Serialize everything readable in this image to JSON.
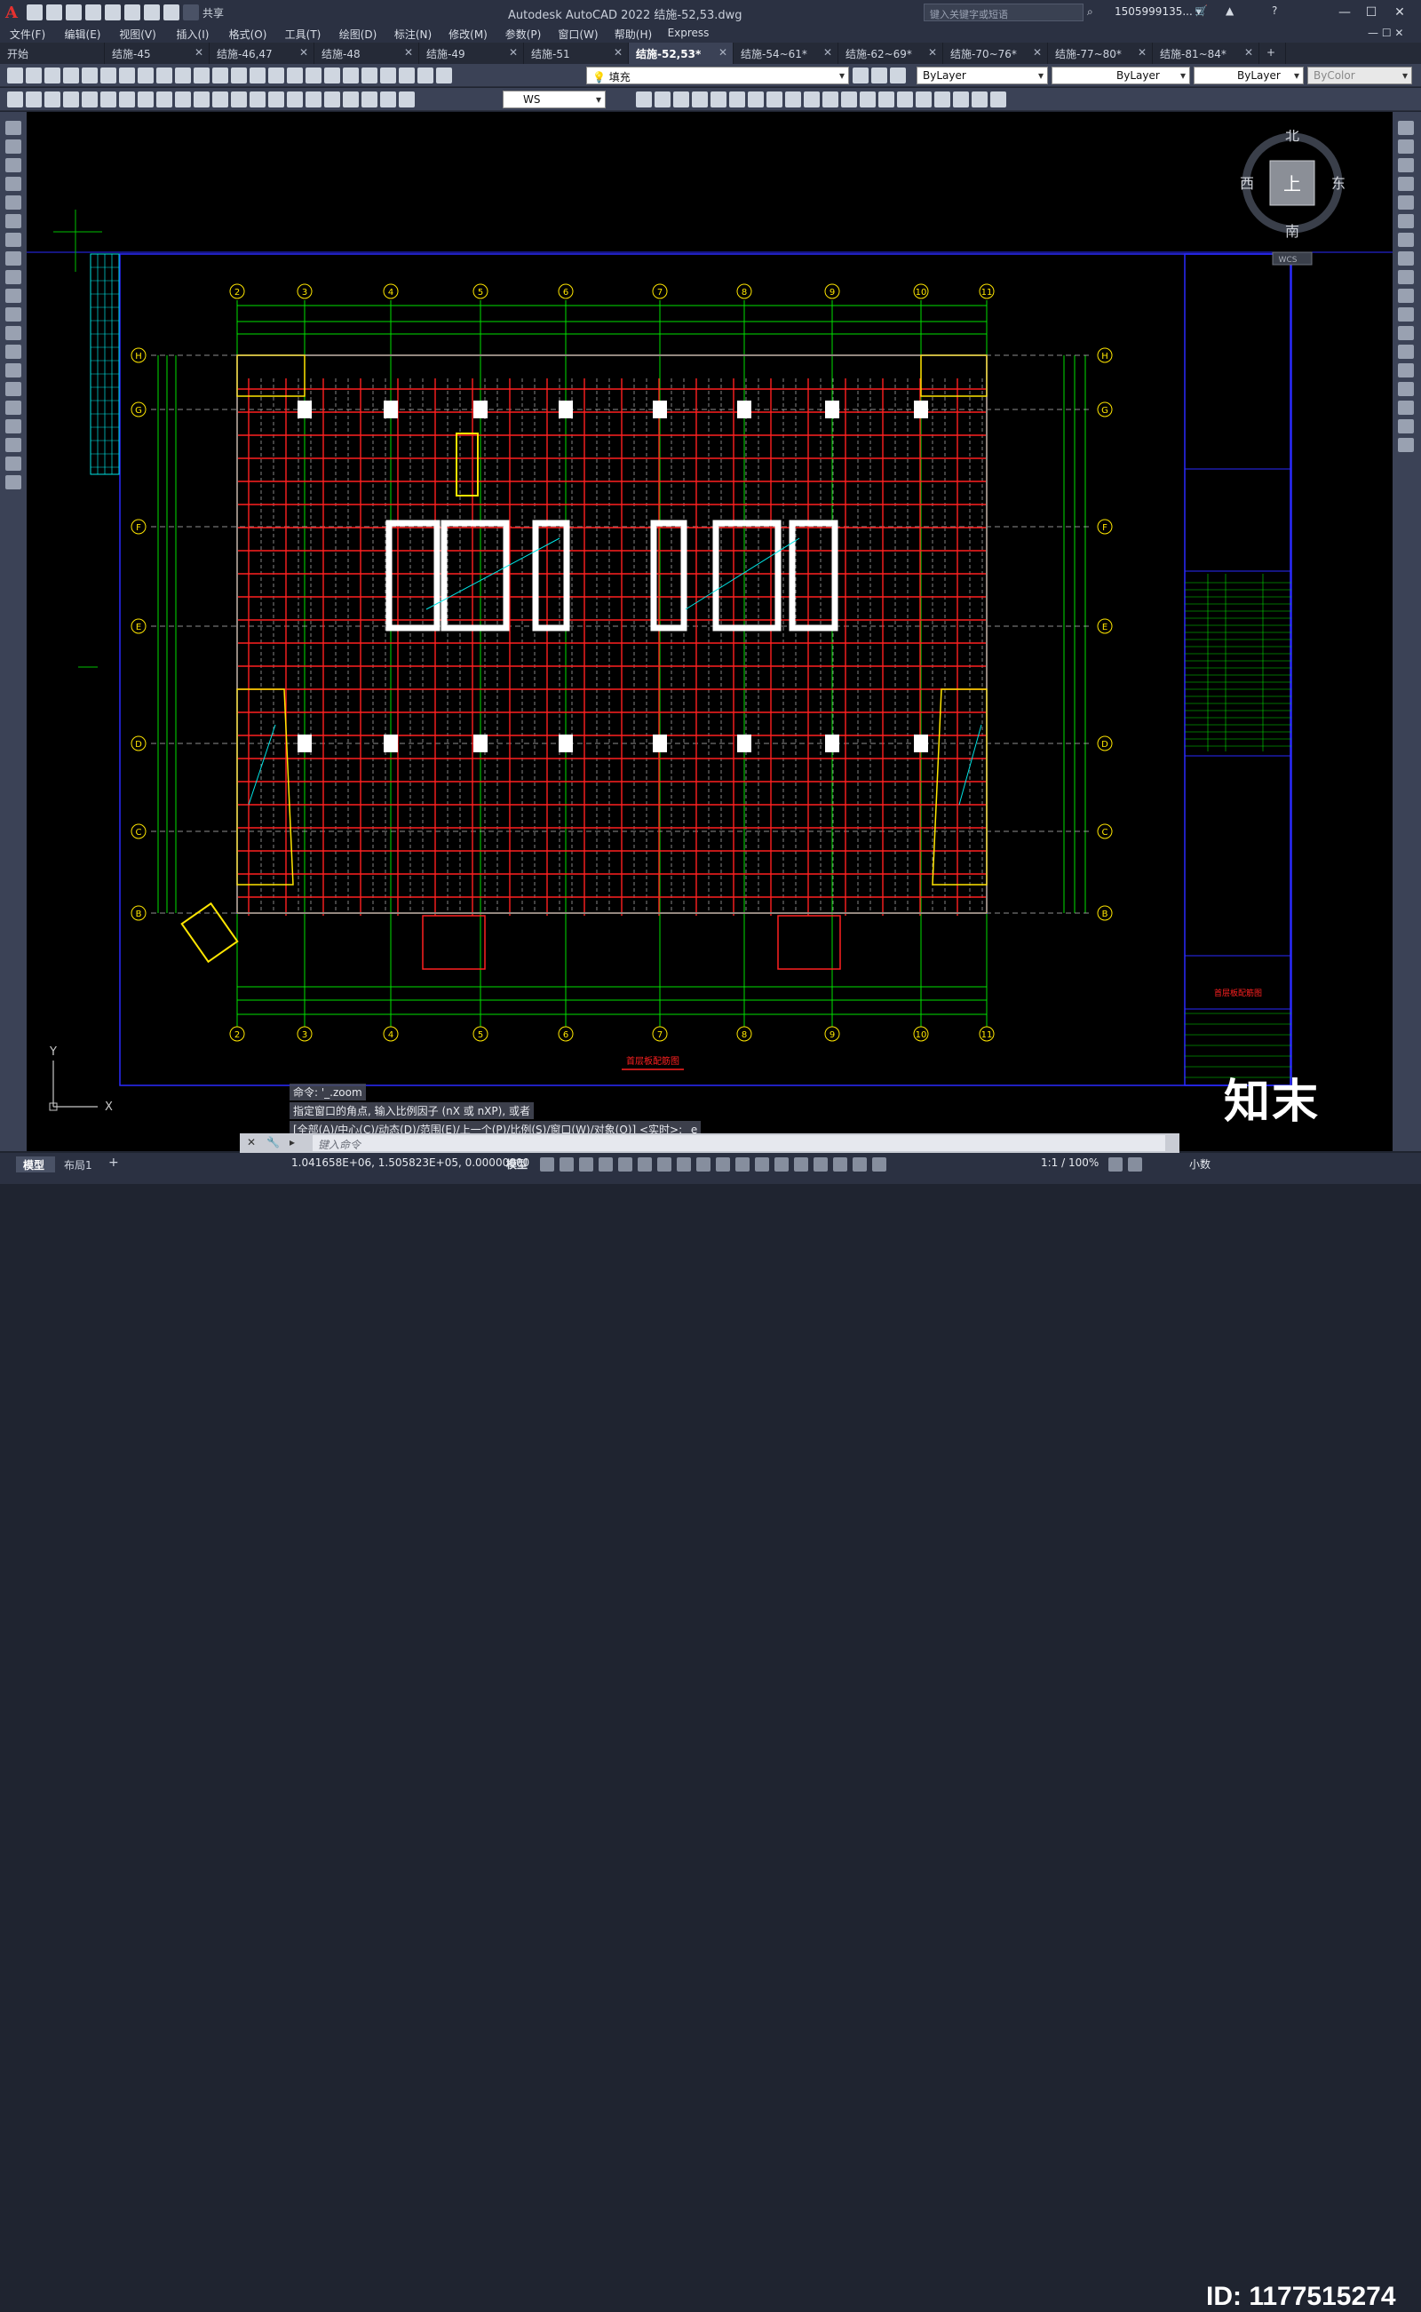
{
  "app": {
    "title": "Autodesk AutoCAD 2022    结施-52,53.dwg",
    "search_placeholder": "键入关键字或短语",
    "user": "1505999135... ▾",
    "logo": "A"
  },
  "menu": [
    "文件(F)",
    "编辑(E)",
    "视图(V)",
    "插入(I)",
    "格式(O)",
    "工具(T)",
    "绘图(D)",
    "标注(N)",
    "修改(M)",
    "参数(P)",
    "窗口(W)",
    "帮助(H)",
    "Express"
  ],
  "share_label": "共享",
  "tabs": [
    {
      "label": "开始"
    },
    {
      "label": "结施-45"
    },
    {
      "label": "结施-46,47"
    },
    {
      "label": "结施-48"
    },
    {
      "label": "结施-49"
    },
    {
      "label": "结施-51"
    },
    {
      "label": "结施-52,53*",
      "active": true
    },
    {
      "label": "结施-54~61*"
    },
    {
      "label": "结施-62~69*"
    },
    {
      "label": "结施-70~76*"
    },
    {
      "label": "结施-77~80*"
    },
    {
      "label": "结施-81~84*"
    }
  ],
  "toolbar": {
    "layer_name": "填充",
    "color": "ByLayer",
    "linetype": "ByLayer",
    "lineweight": "ByLayer",
    "plotstyle": "ByColor",
    "ucs": "WS"
  },
  "viewcube": {
    "north": "北",
    "south": "南",
    "east": "东",
    "west": "西",
    "top": "上",
    "wcs": "WCS"
  },
  "drawing": {
    "axis_top": [
      "2",
      "3",
      "4",
      "5",
      "6",
      "7",
      "8",
      "9",
      "10",
      "11"
    ],
    "axis_side": [
      "H",
      "G",
      "F",
      "E",
      "D",
      "C",
      "B"
    ],
    "plan_title": "首层板配筋图",
    "sheet_title": "首层板配筋图",
    "ucs_x": "X",
    "ucs_y": "Y"
  },
  "command": {
    "history": [
      "命令: '_.zoom",
      "指定窗口的角点, 输入比例因子 (nX 或 nXP), 或者",
      "[全部(A)/中心(C)/动态(D)/范围(E)/上一个(P)/比例(S)/窗口(W)/对象(O)] <实时>: _e"
    ],
    "placeholder": "键入命令"
  },
  "status": {
    "model_tab": "模型",
    "layout_tab": "布局1",
    "coords": "1.041658E+06, 1.505823E+05, 0.00000000",
    "space": "模型",
    "scale": "1:1 / 100%",
    "units": "小数"
  },
  "watermark": {
    "logo": "知末",
    "id": "ID: 1177515274"
  },
  "colors": {
    "red": "#ff2020",
    "green": "#00e000",
    "yellow": "#ffe600",
    "blue": "#2a2aff",
    "cyan": "#00e5e5",
    "white": "#ffffff"
  }
}
